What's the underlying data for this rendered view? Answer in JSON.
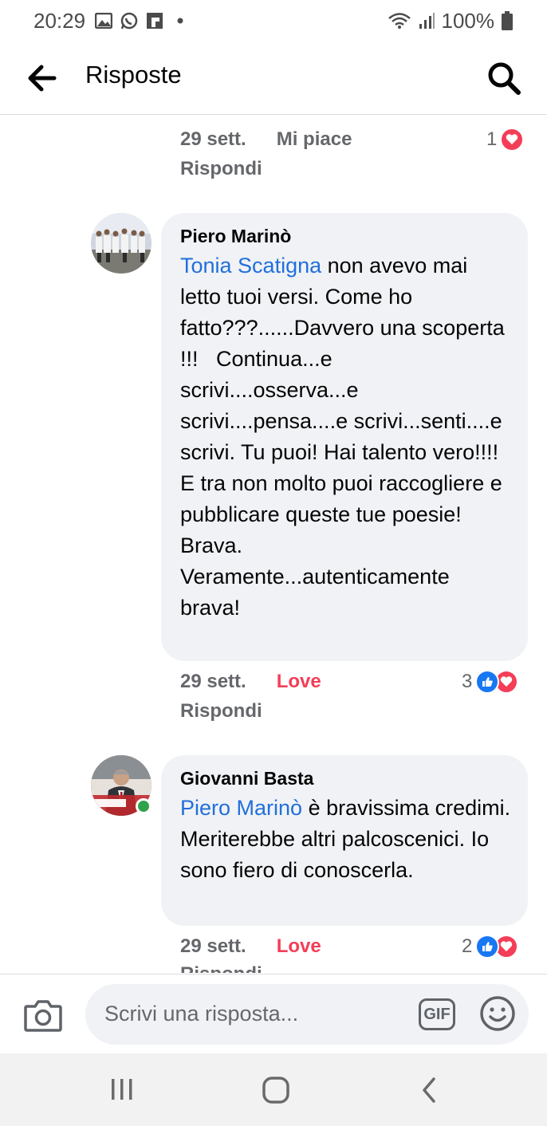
{
  "status_bar": {
    "time": "20:29",
    "battery": "100%",
    "left_icons": [
      "gallery-icon",
      "whatsapp-icon",
      "flipboard-icon",
      "dot-icon"
    ],
    "right_icons": [
      "wifi-icon",
      "signal-icon",
      "battery-icon"
    ]
  },
  "header": {
    "title": "Risposte"
  },
  "comments": [
    {
      "date": "29 sett.",
      "action": "Mi piace",
      "reply": "Rispondi",
      "reaction_count": "1",
      "reactions": [
        "love"
      ]
    },
    {
      "author": "Piero Marinò",
      "mention": "Tonia Scatigna",
      "text": " non avevo mai letto tuoi versi. Come ho fatto???......Davvero una scoperta !!!   Continua...e scrivi....osserva...e scrivi....pensa....e scrivi...senti....e scrivi. Tu puoi! Hai talento vero!!!!  E tra non molto puoi raccogliere e pubblicare queste tue poesie! Brava. Veramente...autenticamente brava!",
      "date": "29 sett.",
      "action": "Love",
      "reply": "Rispondi",
      "reaction_count": "3",
      "reactions": [
        "like",
        "love"
      ]
    },
    {
      "author": "Giovanni Basta",
      "mention": "Piero Marinò",
      "text": " è bravissima credimi. Meriterebbe altri palcoscenici. Io sono fiero di conoscerla.",
      "date": "29 sett.",
      "action": "Love",
      "reply": "Rispondi",
      "reaction_count": "2",
      "reactions": [
        "like",
        "love"
      ],
      "online": true,
      "avatar_badge": "io voto NO"
    }
  ],
  "composer": {
    "placeholder": "Scrivi una risposta...",
    "gif_label": "GIF"
  },
  "colors": {
    "mention": "#216fdb",
    "love": "#f33e58",
    "like": "#1877f2",
    "bubble": "#f0f2f5",
    "secondary_text": "#65676b",
    "online": "#31a24c"
  }
}
